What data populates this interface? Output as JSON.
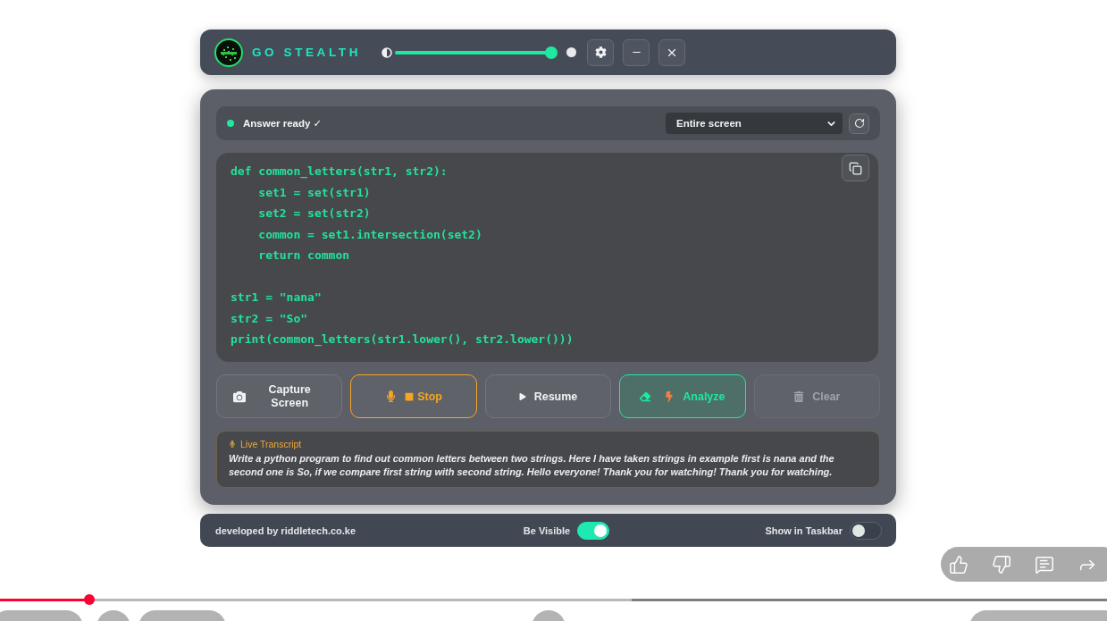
{
  "app_window": {
    "header": {
      "title": "GO STEALTH",
      "opacity_slider": {
        "level": 1
      }
    },
    "status_bar": {
      "text": "Answer ready ✓",
      "ready": true,
      "source_select": {
        "value": "Entire screen"
      }
    },
    "code": "def common_letters(str1, str2):\n    set1 = set(str1)\n    set2 = set(str2)\n    common = set1.intersection(set2)\n    return common\n\nstr1 = \"nana\"\nstr2 = \"So\"\nprint(common_letters(str1.lower(), str2.lower()))",
    "buttons": [
      {
        "kind": "capture",
        "label": "Capture Screen",
        "disabled": false
      },
      {
        "kind": "stop",
        "label": "Stop",
        "disabled": false
      },
      {
        "kind": "resume",
        "label": "Resume",
        "disabled": false
      },
      {
        "kind": "analyze",
        "label": "Analyze",
        "disabled": false
      },
      {
        "kind": "clear",
        "label": "Clear",
        "disabled": true
      }
    ],
    "transcript": {
      "title": "Live Transcript",
      "text": "Write a python program to find out common letters between two strings. Here I have taken strings in example first is nana and the second one is So, if we compare first string with second string. Hello everyone! Thank you for watching! Thank you for watching."
    },
    "footer": {
      "credit": "developed by riddletech.co.ke",
      "toggles": [
        {
          "label": "Be Visible",
          "on": true
        },
        {
          "label": "Show in Taskbar",
          "on": false
        }
      ]
    }
  },
  "video_player": {
    "seek_bar": {
      "level": 0.081,
      "buffer": {
        "level": 0.571
      }
    }
  }
}
